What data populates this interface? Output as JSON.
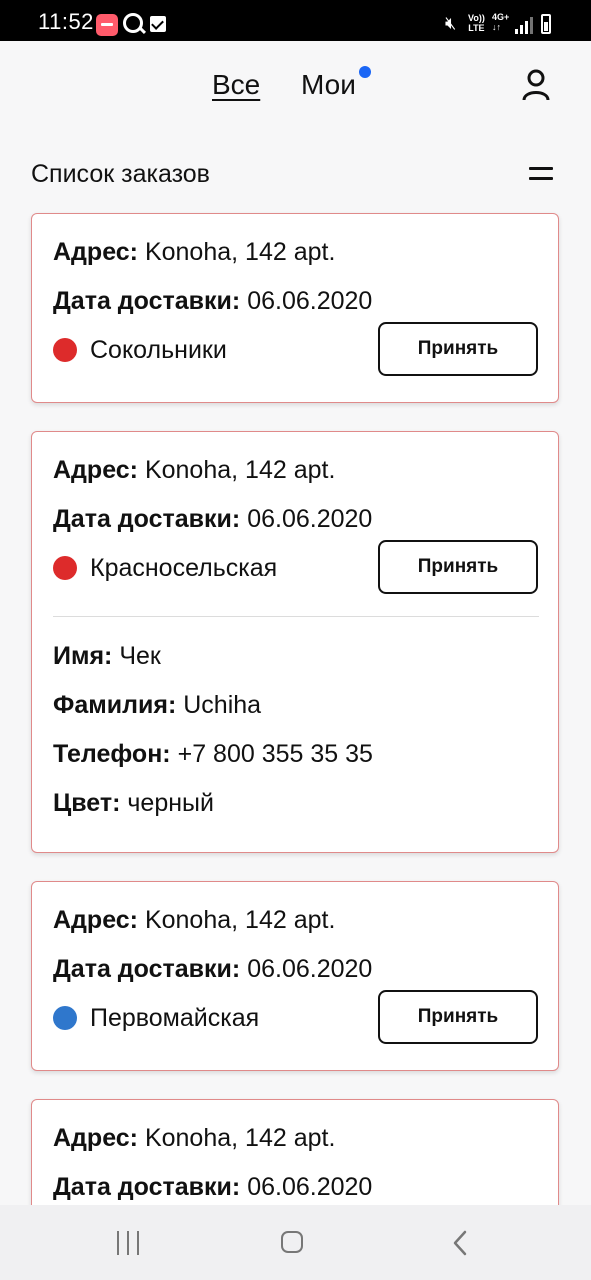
{
  "status_bar": {
    "time": "11:52",
    "volte_line1": "Vo))",
    "volte_line2": "LTE",
    "net_line1": "4G+",
    "net_line2": "↓↑",
    "icons": [
      "app-icon",
      "search-icon",
      "check-icon",
      "mute-icon",
      "signal-icon",
      "battery-icon"
    ]
  },
  "header": {
    "tab_all": "Все",
    "tab_mine": "Мои",
    "notification_color": "#1b66f5",
    "profile_icon": "user-icon"
  },
  "list": {
    "title": "Список заказов",
    "menu_icon": "menu-icon"
  },
  "orders": [
    {
      "address_label": "Адрес:",
      "address": "Konoha, 142 apt.",
      "date_label": "Дата доставки:",
      "date": "06.06.2020",
      "station": "Сокольники",
      "station_color": "#dd2b2b",
      "accept_label": "Принять"
    },
    {
      "address_label": "Адрес:",
      "address": "Konoha, 142 apt.",
      "date_label": "Дата доставки:",
      "date": "06.06.2020",
      "station": "Красносельская",
      "station_color": "#dd2b2b",
      "accept_label": "Принять",
      "details": {
        "name_label": "Имя:",
        "name": "Чек",
        "surname_label": "Фамилия:",
        "surname": "Uchiha",
        "phone_label": "Телефон:",
        "phone": "+7 800 355 35 35",
        "color_label": "Цвет:",
        "color": "черный"
      }
    },
    {
      "address_label": "Адрес:",
      "address": "Konoha, 142 apt.",
      "date_label": "Дата доставки:",
      "date": "06.06.2020",
      "station": "Первомайская",
      "station_color": "#2f77cc",
      "accept_label": "Принять"
    },
    {
      "address_label": "Адрес:",
      "address": "Konoha, 142 apt.",
      "date_label": "Дата доставки:",
      "date": "06.06.2020"
    }
  ],
  "nav_bar": {
    "icons": [
      "recent-apps-icon",
      "home-icon",
      "back-icon"
    ]
  },
  "colors": {
    "card_border": "#e08a8a",
    "station_red": "#dd2b2b",
    "station_blue": "#2f77cc"
  }
}
